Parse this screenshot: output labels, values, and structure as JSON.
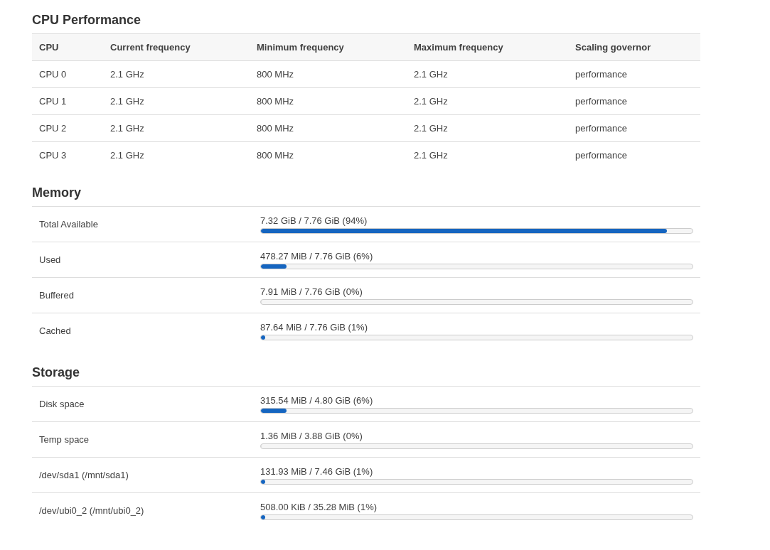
{
  "cpu_performance": {
    "title": "CPU Performance",
    "columns": [
      "CPU",
      "Current frequency",
      "Minimum frequency",
      "Maximum frequency",
      "Scaling governor"
    ],
    "rows": [
      [
        "CPU 0",
        "2.1 GHz",
        "800 MHz",
        "2.1 GHz",
        "performance"
      ],
      [
        "CPU 1",
        "2.1 GHz",
        "800 MHz",
        "2.1 GHz",
        "performance"
      ],
      [
        "CPU 2",
        "2.1 GHz",
        "800 MHz",
        "2.1 GHz",
        "performance"
      ],
      [
        "CPU 3",
        "2.1 GHz",
        "800 MHz",
        "2.1 GHz",
        "performance"
      ]
    ]
  },
  "memory": {
    "title": "Memory",
    "rows": [
      {
        "label": "Total Available",
        "reading": "7.32 GiB / 7.76 GiB (94%)",
        "level": 0.94
      },
      {
        "label": "Used",
        "reading": "478.27 MiB / 7.76 GiB (6%)",
        "level": 0.06
      },
      {
        "label": "Buffered",
        "reading": "7.91 MiB / 7.76 GiB (0%)",
        "level": 0
      },
      {
        "label": "Cached",
        "reading": "87.64 MiB / 7.76 GiB (1%)",
        "level": 0.01
      }
    ]
  },
  "storage": {
    "title": "Storage",
    "rows": [
      {
        "label": "Disk space",
        "reading": "315.54 MiB / 4.80 GiB (6%)",
        "level": 0.06
      },
      {
        "label": "Temp space",
        "reading": "1.36 MiB / 3.88 GiB (0%)",
        "level": 0
      },
      {
        "label": "/dev/sda1 (/mnt/sda1)",
        "reading": "131.93 MiB / 7.46 GiB (1%)",
        "level": 0.01
      },
      {
        "label": "/dev/ubi0_2 (/mnt/ubi0_2)",
        "reading": "508.00 KiB / 35.28 MiB (1%)",
        "level": 0.01
      }
    ]
  }
}
